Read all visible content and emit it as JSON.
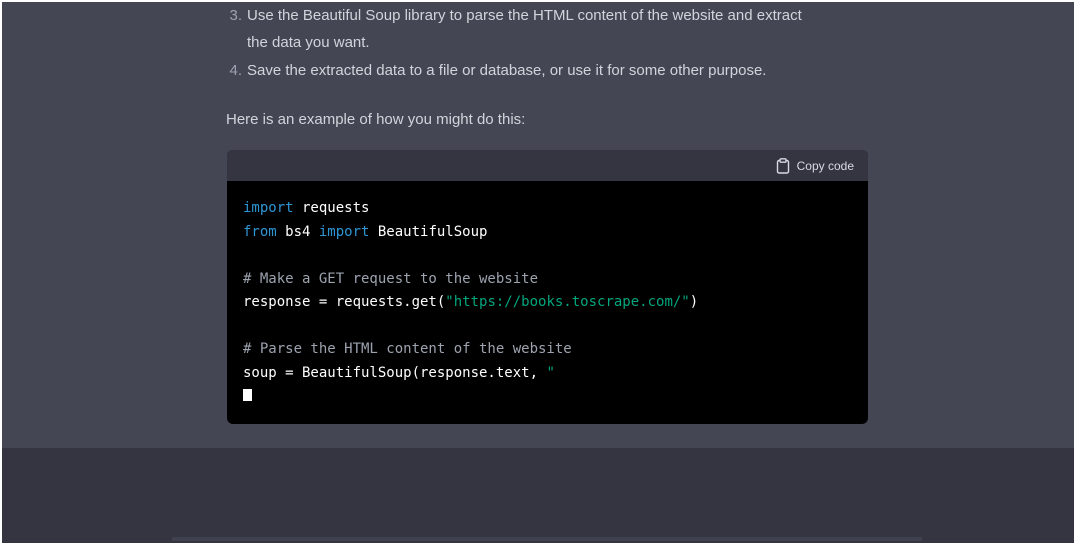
{
  "steps": [
    {
      "number": "3.",
      "lines": [
        "Use the Beautiful Soup library to parse the HTML content of the website and extract",
        "the data you want."
      ]
    },
    {
      "number": "4.",
      "lines": [
        "Save the extracted data to a file or database, or use it for some other purpose."
      ]
    }
  ],
  "intro": "Here is an example of how you might do this:",
  "code_block": {
    "copy_label": "Copy code",
    "lines": [
      [
        {
          "t": "import",
          "c": "kw"
        },
        {
          "t": " requests",
          "c": ""
        }
      ],
      [
        {
          "t": "from",
          "c": "kw"
        },
        {
          "t": " bs4 ",
          "c": ""
        },
        {
          "t": "import",
          "c": "kw"
        },
        {
          "t": " BeautifulSoup",
          "c": ""
        }
      ],
      [],
      [
        {
          "t": "# Make a GET request to the website",
          "c": "cm"
        }
      ],
      [
        {
          "t": "response = requests.get(",
          "c": ""
        },
        {
          "t": "\"https://books.toscrape.com/\"",
          "c": "st"
        },
        {
          "t": ")",
          "c": ""
        }
      ],
      [],
      [
        {
          "t": "# Parse the HTML content of the website",
          "c": "cm"
        }
      ],
      [
        {
          "t": "soup = BeautifulSoup(response.text, ",
          "c": ""
        },
        {
          "t": "\"",
          "c": "st"
        }
      ]
    ]
  }
}
